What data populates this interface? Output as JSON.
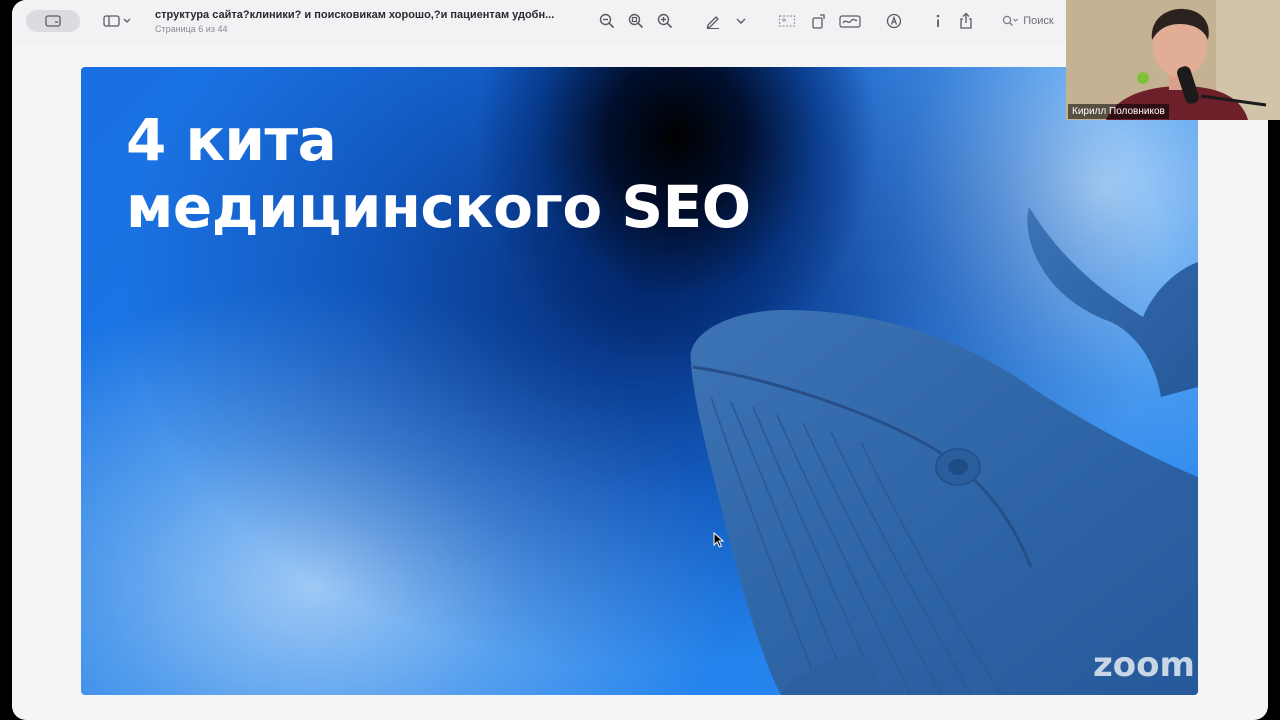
{
  "viewer": {
    "document_title": "структура сайта?клиники? и поисковикам хорошо,?и пациентам удобн...",
    "page_indicator": "Страница 6 из 44",
    "search_label": "Поиск"
  },
  "slide": {
    "title_line1": "4 кита",
    "title_line2": "медицинского SEO"
  },
  "meeting": {
    "participant_name": "Кирилл Половников",
    "watermark": "zoom"
  },
  "icons": [
    "sidebar-icon",
    "view-menu-icon",
    "zoom-out-icon",
    "zoom-fit-icon",
    "zoom-in-icon",
    "markup-pen-icon",
    "chevron-down-icon",
    "crop-icon",
    "rotate-icon",
    "signature-icon",
    "annotate-icon",
    "info-icon",
    "share-icon",
    "search-icon",
    "mouse-cursor-icon"
  ],
  "colors": {
    "slide_blue": "#1d7be8",
    "slide_dark": "#000000",
    "title_text": "#ffffff",
    "whale": "#2f66a8"
  }
}
